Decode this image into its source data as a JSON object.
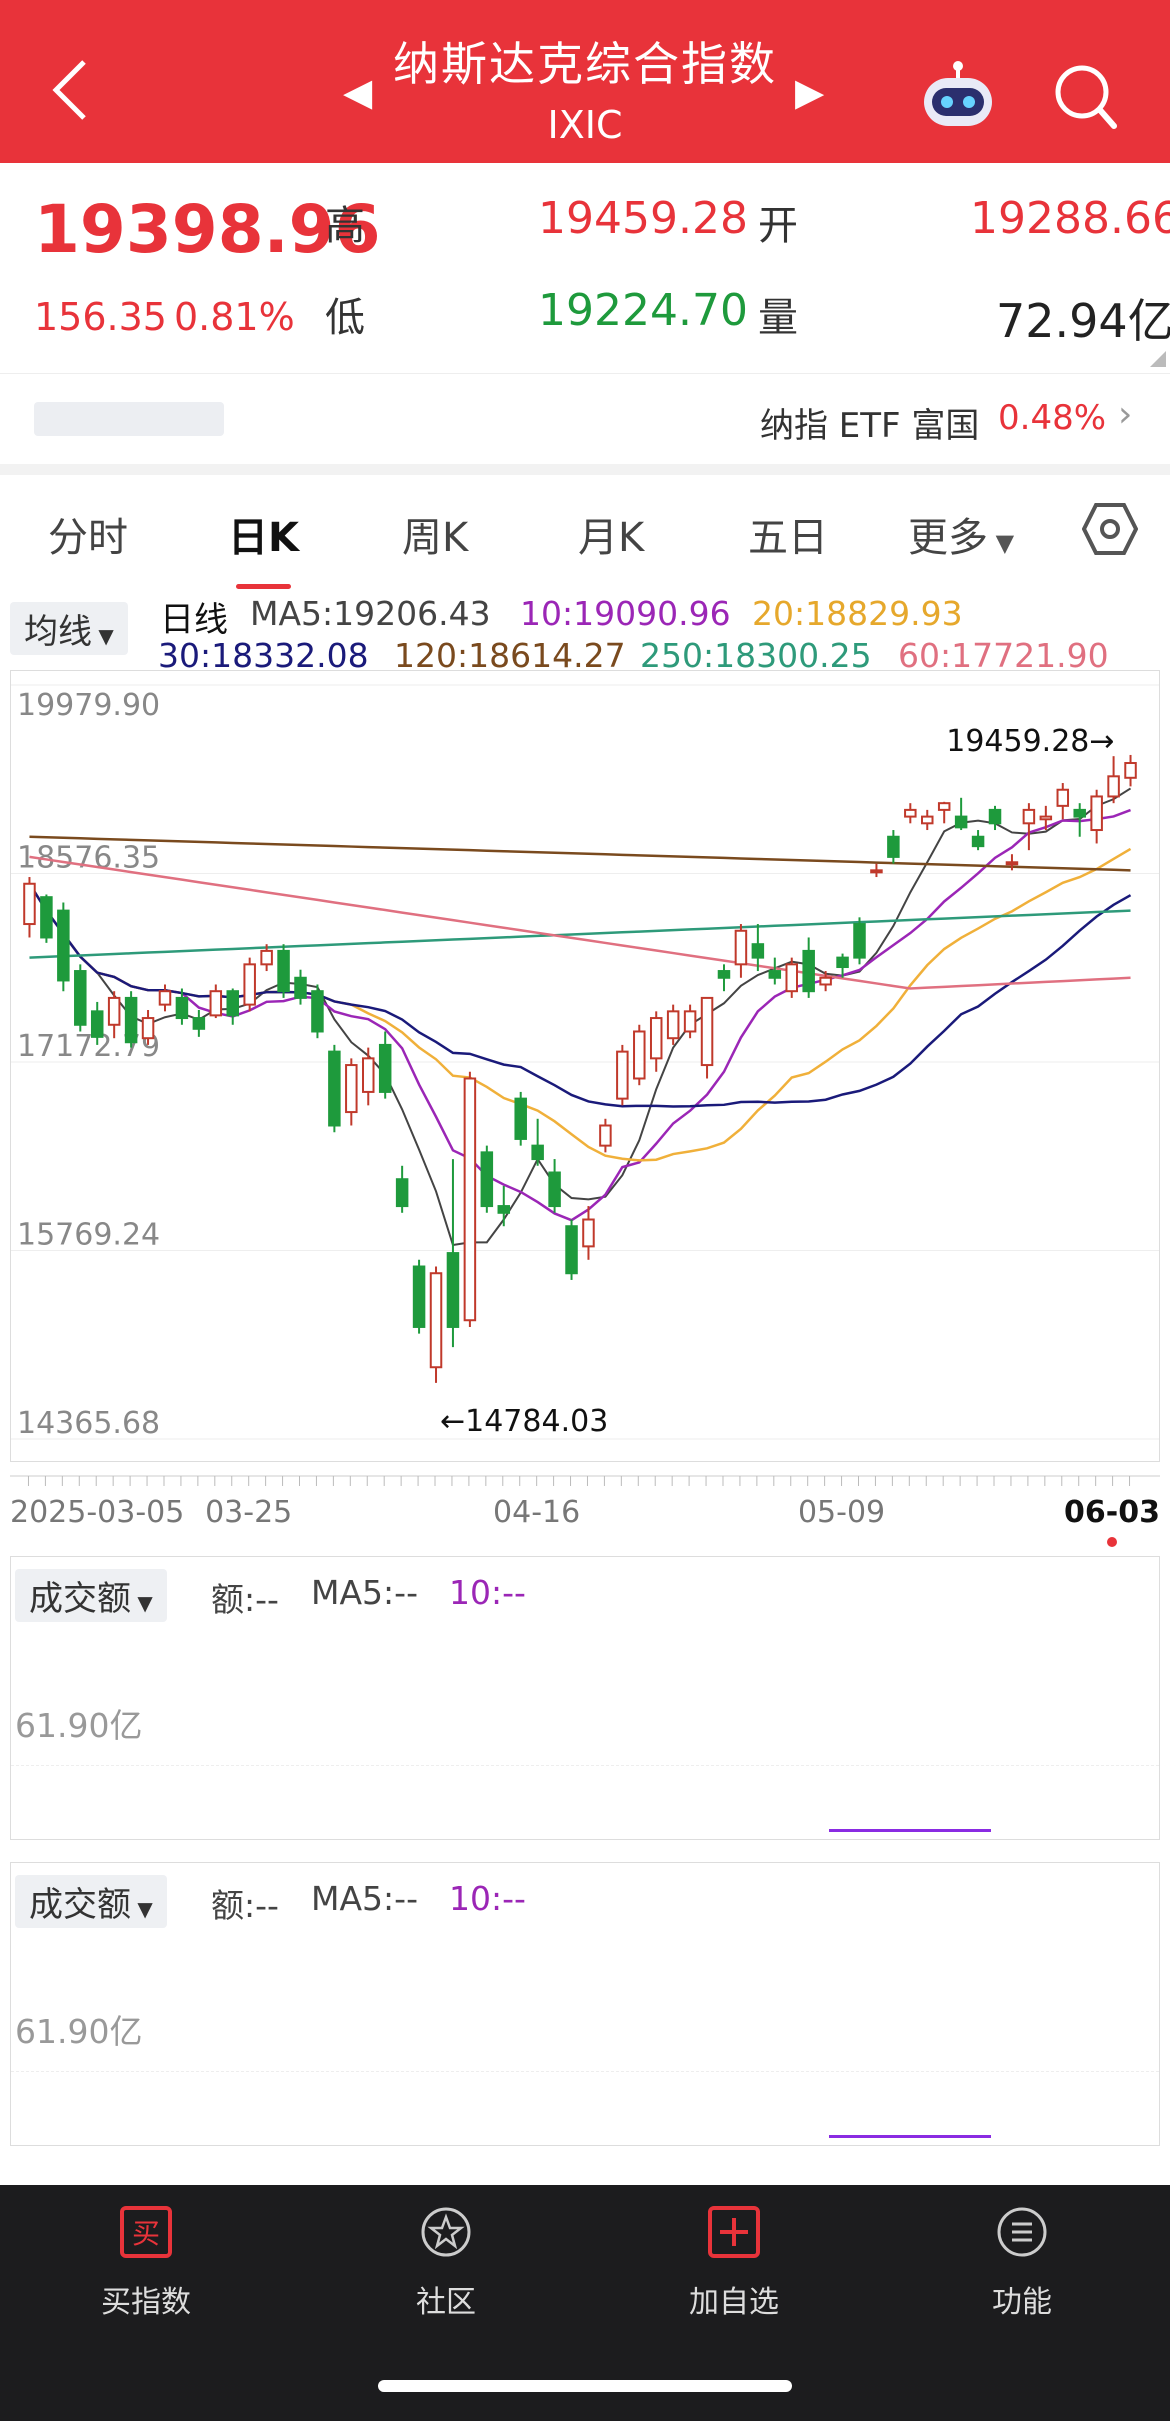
{
  "header": {
    "title": "纳斯达克综合指数",
    "code": "IXIC"
  },
  "quote": {
    "price": "19398.96",
    "change": "156.35",
    "pct": "0.81%",
    "high_label": "高",
    "high": "19459.28",
    "low_label": "低",
    "low": "19224.70",
    "open_label": "开",
    "open": "19288.66",
    "vol_label": "量",
    "vol": "72.94亿"
  },
  "etf": {
    "name": "纳指 ETF 富国",
    "pct": "0.48%"
  },
  "tabs": [
    "分时",
    "日K",
    "周K",
    "月K",
    "五日",
    "更多"
  ],
  "ma_line": {
    "dropdown": "均线",
    "label": "日线",
    "ma5": "MA5:19206.43",
    "ma10": "10:19090.96",
    "ma20": "20:18829.93",
    "ma30": "30:18332.08",
    "ma120": "120:18614.27",
    "ma250": "250:18300.25",
    "ma60": "60:17721.90"
  },
  "colors": {
    "up": "#c0392b",
    "down": "#1e9a3c",
    "ma5": "#444444",
    "ma10": "#9b26b6",
    "ma20": "#f0b03a",
    "ma30": "#1a1a7a",
    "ma120": "#7a4a1e",
    "ma250": "#2e9a7a",
    "ma60": "#e07080"
  },
  "chart_data": {
    "type": "candlestick",
    "y_ticks": [
      "19979.90",
      "18576.35",
      "17172.79",
      "15769.24",
      "14365.68"
    ],
    "ylim": [
      14365.68,
      19979.9
    ],
    "x_ticks": [
      "2025-03-05",
      "03-25",
      "04-16",
      "05-09",
      "06-03"
    ],
    "max_label": "19459.28→",
    "min_label": "←14784.03",
    "ohlc": [
      [
        18200,
        18550,
        18100,
        18500
      ],
      [
        18400,
        18420,
        18060,
        18100
      ],
      [
        18300,
        18360,
        17700,
        17780
      ],
      [
        17850,
        17900,
        17400,
        17450
      ],
      [
        17550,
        17620,
        17300,
        17360
      ],
      [
        17450,
        17700,
        17350,
        17650
      ],
      [
        17650,
        17700,
        17280,
        17320
      ],
      [
        17350,
        17560,
        17300,
        17500
      ],
      [
        17600,
        17750,
        17550,
        17700
      ],
      [
        17650,
        17720,
        17450,
        17500
      ],
      [
        17500,
        17560,
        17360,
        17420
      ],
      [
        17520,
        17750,
        17500,
        17700
      ],
      [
        17700,
        17720,
        17450,
        17520
      ],
      [
        17600,
        17950,
        17550,
        17900
      ],
      [
        17900,
        18050,
        17850,
        18000
      ],
      [
        18000,
        18050,
        17650,
        17700
      ],
      [
        17800,
        17860,
        17600,
        17650
      ],
      [
        17700,
        17750,
        17350,
        17400
      ],
      [
        17250,
        17300,
        16650,
        16700
      ],
      [
        16800,
        17200,
        16700,
        17150
      ],
      [
        16950,
        17280,
        16850,
        17200
      ],
      [
        17300,
        17400,
        16900,
        16950
      ],
      [
        16300,
        16400,
        16050,
        16100
      ],
      [
        15650,
        15700,
        15150,
        15200
      ],
      [
        14900,
        15650,
        14784,
        15600
      ],
      [
        15750,
        16450,
        15050,
        15200
      ],
      [
        15250,
        17100,
        15200,
        17050
      ],
      [
        16500,
        16550,
        16050,
        16100
      ],
      [
        16100,
        16250,
        15950,
        16050
      ],
      [
        16900,
        16950,
        16550,
        16600
      ],
      [
        16550,
        16750,
        16400,
        16450
      ],
      [
        16350,
        16450,
        16050,
        16100
      ],
      [
        15950,
        16000,
        15550,
        15600
      ],
      [
        15800,
        16100,
        15700,
        16000
      ],
      [
        16550,
        16750,
        16500,
        16700
      ],
      [
        16900,
        17300,
        16850,
        17250
      ],
      [
        17050,
        17450,
        17000,
        17400
      ],
      [
        17200,
        17550,
        17100,
        17500
      ],
      [
        17350,
        17600,
        17300,
        17550
      ],
      [
        17400,
        17600,
        17350,
        17550
      ],
      [
        17150,
        17650,
        17050,
        17650
      ],
      [
        17850,
        17900,
        17700,
        17800
      ],
      [
        17900,
        18200,
        17800,
        18150
      ],
      [
        18050,
        18200,
        17850,
        17950
      ],
      [
        17850,
        17950,
        17750,
        17800
      ],
      [
        17700,
        17950,
        17650,
        17900
      ],
      [
        18000,
        18100,
        17650,
        17700
      ],
      [
        17750,
        17850,
        17700,
        17800
      ],
      [
        17950,
        17980,
        17800,
        17880
      ],
      [
        18200,
        18250,
        17900,
        17950
      ],
      [
        18600,
        18650,
        18550,
        18600
      ],
      [
        18850,
        18900,
        18650,
        18700
      ],
      [
        19000,
        19100,
        18950,
        19050
      ],
      [
        18950,
        19050,
        18900,
        19000
      ],
      [
        19050,
        19110,
        18950,
        19100
      ],
      [
        19000,
        19140,
        18900,
        18920
      ],
      [
        18850,
        18900,
        18750,
        18780
      ],
      [
        19050,
        19080,
        18900,
        18950
      ],
      [
        18650,
        18720,
        18600,
        18660
      ],
      [
        18950,
        19100,
        18750,
        19050
      ],
      [
        18980,
        19080,
        18900,
        19000
      ],
      [
        19080,
        19250,
        18980,
        19200
      ],
      [
        19050,
        19100,
        18850,
        19000
      ],
      [
        18900,
        19200,
        18800,
        19150
      ],
      [
        19150,
        19450,
        19100,
        19300
      ],
      [
        19289,
        19459,
        19225,
        19399
      ]
    ]
  },
  "volume_panels": [
    {
      "dropdown": "成交额",
      "amount": "额:--",
      "ma5": "MA5:--",
      "ma10": "10:--",
      "axis": "61.90亿"
    },
    {
      "dropdown": "成交额",
      "amount": "额:--",
      "ma5": "MA5:--",
      "ma10": "10:--",
      "axis": "61.90亿"
    }
  ],
  "nav": [
    {
      "label": "买指数",
      "icon": "buy-icon"
    },
    {
      "label": "社区",
      "icon": "community-icon"
    },
    {
      "label": "加自选",
      "icon": "add-watchlist-icon"
    },
    {
      "label": "功能",
      "icon": "menu-icon"
    }
  ]
}
